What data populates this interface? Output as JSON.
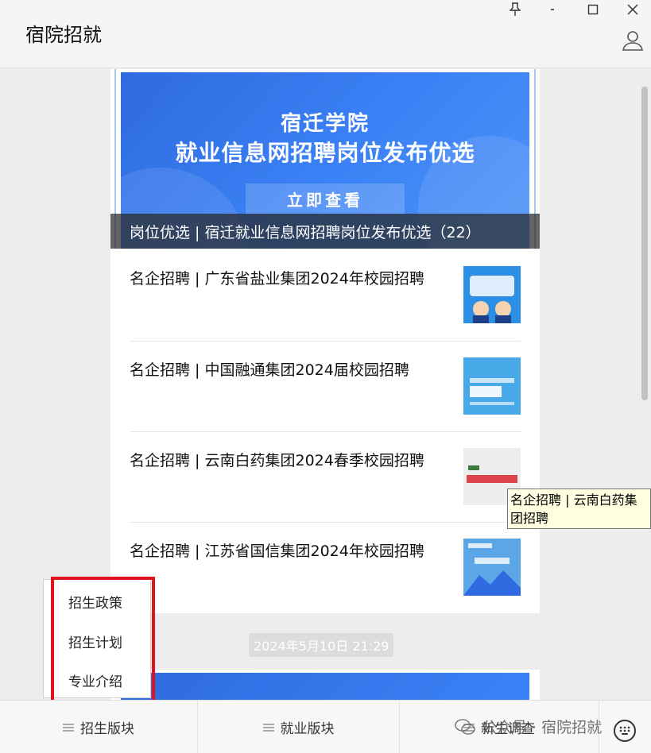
{
  "window": {
    "title": "宿院招就",
    "pin_glyph": "⚲",
    "minimize_glyph": "−",
    "maximize_glyph": "☐",
    "close_glyph": "✕"
  },
  "feed": {
    "banner": {
      "line1": "宿迁学院",
      "line2": "就业信息网招聘岗位发布优选",
      "button": "立即查看",
      "caption": "岗位优选 | 宿迁就业信息网招聘岗位发布优选（22）"
    },
    "articles": [
      {
        "title": "名企招聘 | 广东省盐业集团2024年校园招聘",
        "thumb_color": "#2b8fe6"
      },
      {
        "title": "名企招聘 | 中国融通集团2024届校园招聘",
        "thumb_color": "#48a9e8"
      },
      {
        "title": "名企招聘 | 云南白药集团2024春季校园招聘",
        "thumb_color": "#eeeeee"
      },
      {
        "title": "名企招聘 | 江苏省国信集团2024年校园招聘",
        "thumb_color": "#5aa6e6"
      }
    ],
    "timestamp": "2024年5月10日 21:29"
  },
  "tooltip": {
    "text": "名企招聘 | 云南白药集团招聘"
  },
  "popup_menu": {
    "items": [
      {
        "label": "招生政策"
      },
      {
        "label": "招生计划"
      },
      {
        "label": "专业介绍"
      }
    ]
  },
  "bottom_tabs": [
    {
      "label": "招生版块"
    },
    {
      "label": "就业版块"
    },
    {
      "label": "新生调查"
    }
  ],
  "watermark": {
    "text": "公众号 · 宿院招就"
  },
  "colors": {
    "banner_blue": "#3b82f6",
    "highlight_red": "#e0141e",
    "tooltip_bg": "#ffffe1"
  }
}
